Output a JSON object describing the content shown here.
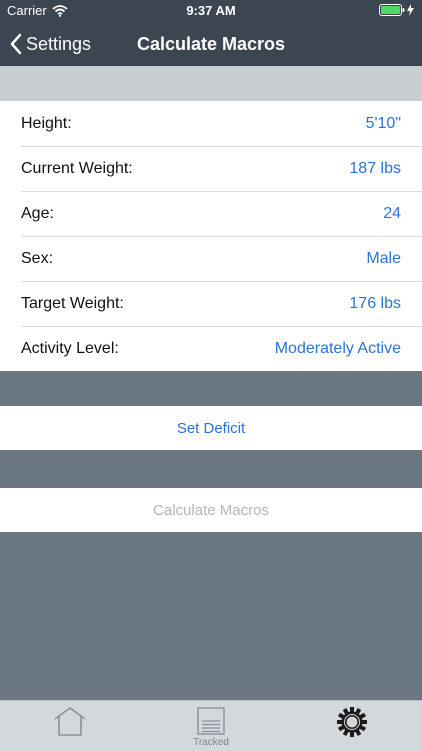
{
  "status_bar": {
    "carrier": "Carrier",
    "time": "9:37 AM",
    "battery_color": "#4cd964"
  },
  "nav": {
    "back_label": "Settings",
    "title": "Calculate Macros"
  },
  "form": {
    "rows": [
      {
        "label": "Height:",
        "value": "5'10\""
      },
      {
        "label": "Current Weight:",
        "value": "187 lbs"
      },
      {
        "label": "Age:",
        "value": "24"
      },
      {
        "label": "Sex:",
        "value": "Male"
      },
      {
        "label": "Target Weight:",
        "value": "176 lbs"
      },
      {
        "label": "Activity Level:",
        "value": "Moderately Active"
      }
    ]
  },
  "actions": {
    "set_deficit": "Set Deficit",
    "calculate": "Calculate Macros"
  },
  "tab_bar": {
    "tabs": [
      {
        "icon": "home-icon",
        "label": ""
      },
      {
        "icon": "tracked-icon",
        "label": "Tracked"
      },
      {
        "icon": "settings-gear-icon",
        "label": ""
      }
    ]
  },
  "colors": {
    "accent": "#2b73d6",
    "nav_bg": "#3b4651",
    "disabled_text": "#b5b5b5"
  }
}
